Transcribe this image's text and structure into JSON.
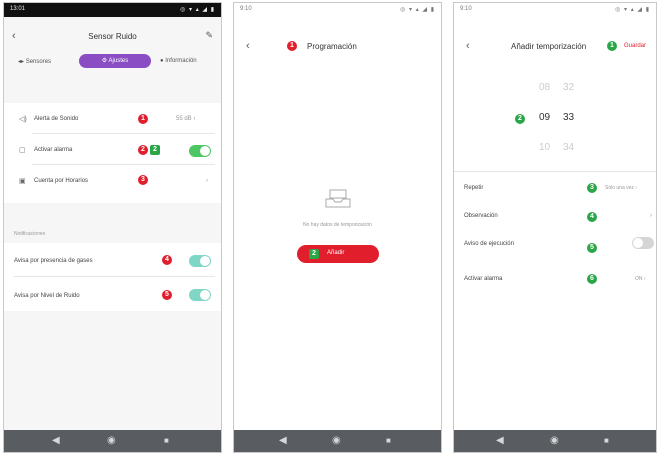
{
  "screen1": {
    "status_time": "13:01",
    "status_icons": "◎ ▾ ▴ ◢ ▮",
    "title": "Sensor Ruido",
    "tabs": [
      {
        "label": "Sensores"
      },
      {
        "label": "Ajustes",
        "active": true
      },
      {
        "label": "Información"
      }
    ],
    "rows": [
      {
        "label": "Alerta de Sonido",
        "value": "55 dB",
        "badge": "1"
      },
      {
        "label": "Activar alarma",
        "badge": "2",
        "extra_badge": "2",
        "toggle": true
      },
      {
        "label": "Cuenta por Horarios",
        "badge": "3"
      }
    ],
    "section_header": "Notificaciones",
    "notif_rows": [
      {
        "label": "Avisa por presencia de gases",
        "badge": "4",
        "toggle": true
      },
      {
        "label": "Avisa por Nivel de Ruido",
        "badge": "5",
        "toggle": true
      }
    ]
  },
  "screen2": {
    "status_time": "9:10",
    "status_icons": "◎ ▾ ▴ ◢ ▮",
    "title": "Programación",
    "badge": "1",
    "empty_text": "No hay datos de temporización",
    "add_button": "Añadir",
    "add_badge": "2"
  },
  "screen3": {
    "status_time": "9:10",
    "status_icons": "◎ ▾ ▴ ◢ ▮",
    "title": "Añadir temporización",
    "title_badge": "1",
    "save_label": "Guardar",
    "picker": {
      "above": [
        "08",
        "32"
      ],
      "selected": [
        "09",
        "33"
      ],
      "below": [
        "10",
        "34"
      ],
      "badge": "2"
    },
    "rows": [
      {
        "label": "Repetir",
        "value": "Sólo una vez",
        "badge": "3"
      },
      {
        "label": "Observación",
        "badge": "4"
      },
      {
        "label": "Aviso de ejecución",
        "badge": "5",
        "toggle": true
      },
      {
        "label": "Activar alarma",
        "value": "ON",
        "badge": "6"
      }
    ]
  },
  "colors": {
    "accent_purple": "#8a4dc3",
    "badge_red": "#e01e2c",
    "badge_green": "#2aa648",
    "toggle_green": "#4cc763",
    "toggle_teal": "#7fd6c5",
    "navbar": "#595c60"
  },
  "icons": {
    "nav_back": "◀",
    "nav_home": "◉",
    "nav_recent": "■"
  }
}
